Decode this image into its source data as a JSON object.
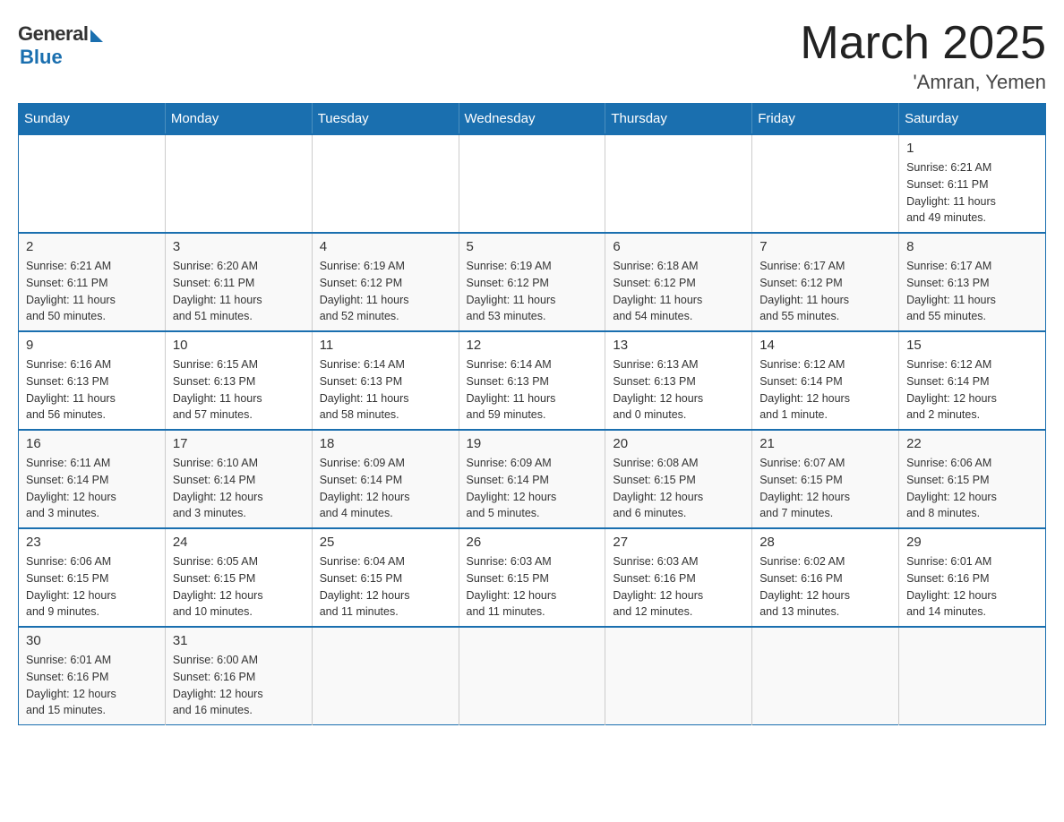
{
  "header": {
    "logo_general": "General",
    "logo_blue": "Blue",
    "month_title": "March 2025",
    "location": "'Amran, Yemen"
  },
  "weekdays": [
    "Sunday",
    "Monday",
    "Tuesday",
    "Wednesday",
    "Thursday",
    "Friday",
    "Saturday"
  ],
  "weeks": [
    [
      {
        "day": "",
        "info": ""
      },
      {
        "day": "",
        "info": ""
      },
      {
        "day": "",
        "info": ""
      },
      {
        "day": "",
        "info": ""
      },
      {
        "day": "",
        "info": ""
      },
      {
        "day": "",
        "info": ""
      },
      {
        "day": "1",
        "info": "Sunrise: 6:21 AM\nSunset: 6:11 PM\nDaylight: 11 hours\nand 49 minutes."
      }
    ],
    [
      {
        "day": "2",
        "info": "Sunrise: 6:21 AM\nSunset: 6:11 PM\nDaylight: 11 hours\nand 50 minutes."
      },
      {
        "day": "3",
        "info": "Sunrise: 6:20 AM\nSunset: 6:11 PM\nDaylight: 11 hours\nand 51 minutes."
      },
      {
        "day": "4",
        "info": "Sunrise: 6:19 AM\nSunset: 6:12 PM\nDaylight: 11 hours\nand 52 minutes."
      },
      {
        "day": "5",
        "info": "Sunrise: 6:19 AM\nSunset: 6:12 PM\nDaylight: 11 hours\nand 53 minutes."
      },
      {
        "day": "6",
        "info": "Sunrise: 6:18 AM\nSunset: 6:12 PM\nDaylight: 11 hours\nand 54 minutes."
      },
      {
        "day": "7",
        "info": "Sunrise: 6:17 AM\nSunset: 6:12 PM\nDaylight: 11 hours\nand 55 minutes."
      },
      {
        "day": "8",
        "info": "Sunrise: 6:17 AM\nSunset: 6:13 PM\nDaylight: 11 hours\nand 55 minutes."
      }
    ],
    [
      {
        "day": "9",
        "info": "Sunrise: 6:16 AM\nSunset: 6:13 PM\nDaylight: 11 hours\nand 56 minutes."
      },
      {
        "day": "10",
        "info": "Sunrise: 6:15 AM\nSunset: 6:13 PM\nDaylight: 11 hours\nand 57 minutes."
      },
      {
        "day": "11",
        "info": "Sunrise: 6:14 AM\nSunset: 6:13 PM\nDaylight: 11 hours\nand 58 minutes."
      },
      {
        "day": "12",
        "info": "Sunrise: 6:14 AM\nSunset: 6:13 PM\nDaylight: 11 hours\nand 59 minutes."
      },
      {
        "day": "13",
        "info": "Sunrise: 6:13 AM\nSunset: 6:13 PM\nDaylight: 12 hours\nand 0 minutes."
      },
      {
        "day": "14",
        "info": "Sunrise: 6:12 AM\nSunset: 6:14 PM\nDaylight: 12 hours\nand 1 minute."
      },
      {
        "day": "15",
        "info": "Sunrise: 6:12 AM\nSunset: 6:14 PM\nDaylight: 12 hours\nand 2 minutes."
      }
    ],
    [
      {
        "day": "16",
        "info": "Sunrise: 6:11 AM\nSunset: 6:14 PM\nDaylight: 12 hours\nand 3 minutes."
      },
      {
        "day": "17",
        "info": "Sunrise: 6:10 AM\nSunset: 6:14 PM\nDaylight: 12 hours\nand 3 minutes."
      },
      {
        "day": "18",
        "info": "Sunrise: 6:09 AM\nSunset: 6:14 PM\nDaylight: 12 hours\nand 4 minutes."
      },
      {
        "day": "19",
        "info": "Sunrise: 6:09 AM\nSunset: 6:14 PM\nDaylight: 12 hours\nand 5 minutes."
      },
      {
        "day": "20",
        "info": "Sunrise: 6:08 AM\nSunset: 6:15 PM\nDaylight: 12 hours\nand 6 minutes."
      },
      {
        "day": "21",
        "info": "Sunrise: 6:07 AM\nSunset: 6:15 PM\nDaylight: 12 hours\nand 7 minutes."
      },
      {
        "day": "22",
        "info": "Sunrise: 6:06 AM\nSunset: 6:15 PM\nDaylight: 12 hours\nand 8 minutes."
      }
    ],
    [
      {
        "day": "23",
        "info": "Sunrise: 6:06 AM\nSunset: 6:15 PM\nDaylight: 12 hours\nand 9 minutes."
      },
      {
        "day": "24",
        "info": "Sunrise: 6:05 AM\nSunset: 6:15 PM\nDaylight: 12 hours\nand 10 minutes."
      },
      {
        "day": "25",
        "info": "Sunrise: 6:04 AM\nSunset: 6:15 PM\nDaylight: 12 hours\nand 11 minutes."
      },
      {
        "day": "26",
        "info": "Sunrise: 6:03 AM\nSunset: 6:15 PM\nDaylight: 12 hours\nand 11 minutes."
      },
      {
        "day": "27",
        "info": "Sunrise: 6:03 AM\nSunset: 6:16 PM\nDaylight: 12 hours\nand 12 minutes."
      },
      {
        "day": "28",
        "info": "Sunrise: 6:02 AM\nSunset: 6:16 PM\nDaylight: 12 hours\nand 13 minutes."
      },
      {
        "day": "29",
        "info": "Sunrise: 6:01 AM\nSunset: 6:16 PM\nDaylight: 12 hours\nand 14 minutes."
      }
    ],
    [
      {
        "day": "30",
        "info": "Sunrise: 6:01 AM\nSunset: 6:16 PM\nDaylight: 12 hours\nand 15 minutes."
      },
      {
        "day": "31",
        "info": "Sunrise: 6:00 AM\nSunset: 6:16 PM\nDaylight: 12 hours\nand 16 minutes."
      },
      {
        "day": "",
        "info": ""
      },
      {
        "day": "",
        "info": ""
      },
      {
        "day": "",
        "info": ""
      },
      {
        "day": "",
        "info": ""
      },
      {
        "day": "",
        "info": ""
      }
    ]
  ]
}
